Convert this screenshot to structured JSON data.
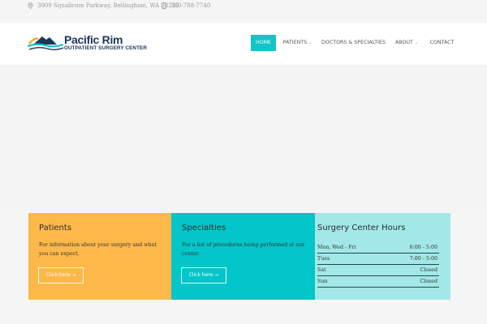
{
  "topbar": {
    "address": "3009 Squalicum Parkway, Bellingham, WA 98225",
    "phone": "360-788-7740",
    "icons": [
      "location-pin-icon",
      "phone-icon"
    ]
  },
  "logo": {
    "name": "Pacific Rim",
    "subtitle": "OUTPATIENT SURGERY CENTER"
  },
  "nav": {
    "items": [
      {
        "label": "HOME",
        "active": true,
        "dropdown": false
      },
      {
        "label": "PATIENTS",
        "active": false,
        "dropdown": true
      },
      {
        "label": "DOCTORS & SPECIALTIES",
        "active": false,
        "dropdown": false
      },
      {
        "label": "ABOUT",
        "active": false,
        "dropdown": true
      },
      {
        "label": "CONTACT",
        "active": false,
        "dropdown": false
      }
    ],
    "dropdown_glyph": "⌄",
    "accent": "#13c4c8"
  },
  "panels": {
    "patients": {
      "title": "Patients",
      "text": "For information about your surgery and what you can expect.",
      "button": "Click here  →",
      "color": "#fdb84a"
    },
    "specialties": {
      "title": "Specialties",
      "text": "For a list of procedures being performed at our center.",
      "button": "Click here  →",
      "color": "#02c6c9"
    },
    "hours": {
      "title": "Surgery Center Hours",
      "color": "#a3e8e8",
      "rows": [
        {
          "day": "Mon, Wed - Fri",
          "time": "6:00 - 5:00"
        },
        {
          "day": "Tues",
          "time": "7:00 - 5:00"
        },
        {
          "day": "Sat",
          "time": "Closed"
        },
        {
          "day": "Sun",
          "time": "Closed"
        }
      ]
    }
  }
}
